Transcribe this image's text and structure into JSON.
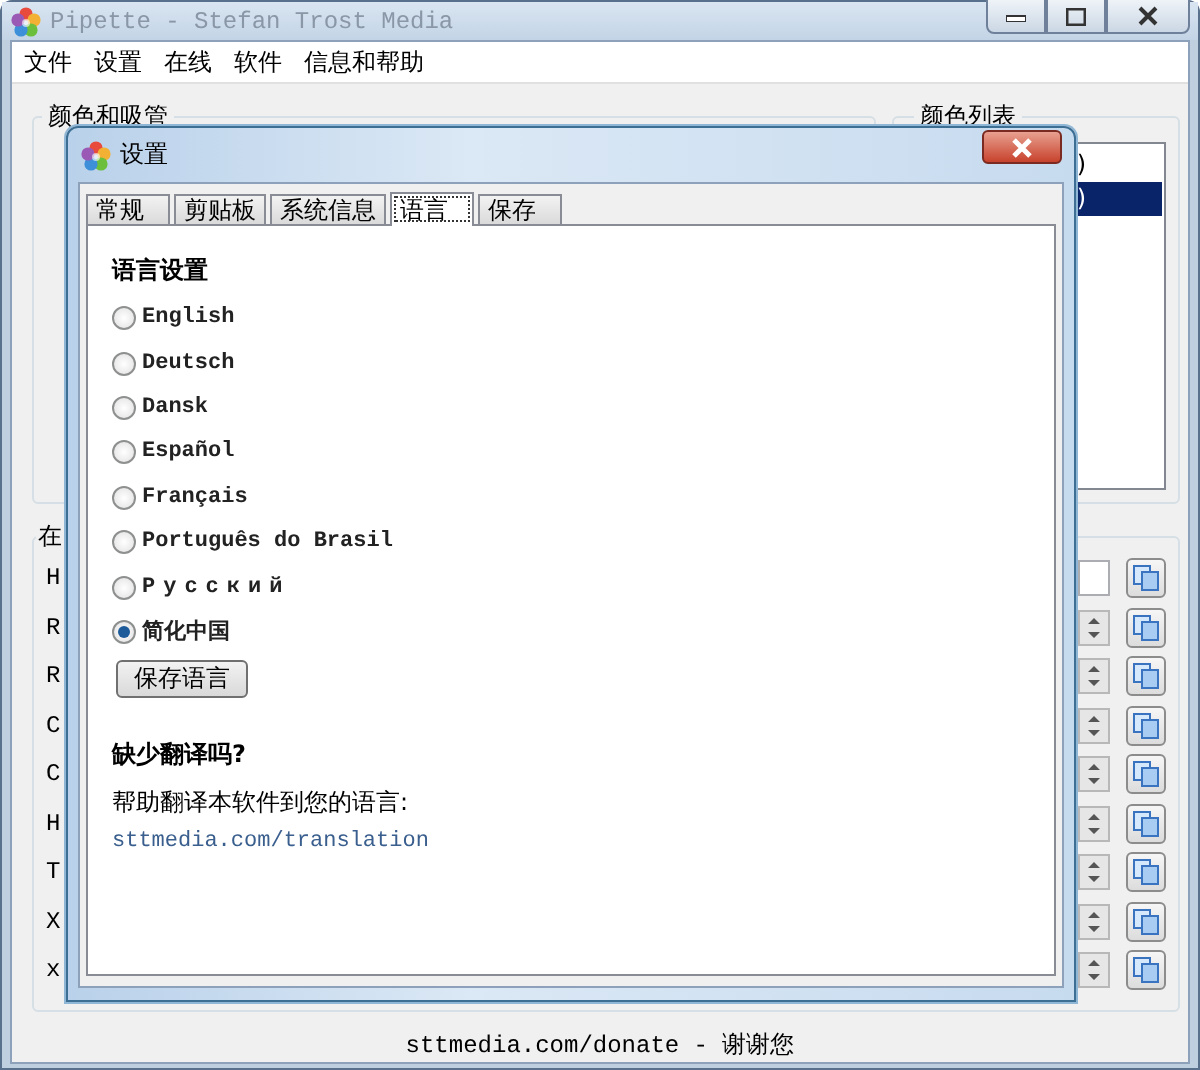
{
  "window": {
    "title": "Pipette - Stefan Trost Media"
  },
  "menu": [
    "文件",
    "设置",
    "在线",
    "软件",
    "信息和帮助"
  ],
  "color_group": {
    "title": "颜色和吸管"
  },
  "color_list": {
    "title": "颜色列表",
    "items": [
      {
        "text": ")",
        "selected": false
      },
      {
        "text": ")",
        "selected": true
      }
    ]
  },
  "values_group": {
    "title": "在",
    "rows": [
      {
        "label": "H",
        "kind": "field"
      },
      {
        "label": "R",
        "kind": "spinner"
      },
      {
        "label": "R",
        "kind": "spinner"
      },
      {
        "label": "C",
        "kind": "spinner"
      },
      {
        "label": "C",
        "kind": "spinner"
      },
      {
        "label": "H",
        "kind": "spinner"
      },
      {
        "label": "T",
        "kind": "spinner"
      },
      {
        "label": "X",
        "kind": "spinner"
      },
      {
        "label": "x",
        "kind": "spinner"
      }
    ]
  },
  "footer": "sttmedia.com/donate - 谢谢您",
  "dialog": {
    "title": "设置",
    "tabs": [
      {
        "label": "常规",
        "selected": false
      },
      {
        "label": "剪贴板",
        "selected": false
      },
      {
        "label": "系统信息",
        "selected": false
      },
      {
        "label": "语言",
        "selected": true
      },
      {
        "label": "保存",
        "selected": false
      }
    ],
    "heading": "语言设置",
    "languages": [
      {
        "label": "English",
        "selected": false
      },
      {
        "label": "Deutsch",
        "selected": false
      },
      {
        "label": "Dansk",
        "selected": false
      },
      {
        "label": "Español",
        "selected": false
      },
      {
        "label": "Français",
        "selected": false
      },
      {
        "label": "Português do Brasil",
        "selected": false
      },
      {
        "label": "Русский",
        "selected": false
      },
      {
        "label": "简化中国",
        "selected": true
      }
    ],
    "save_button": "保存语言",
    "missing_heading": "缺少翻译吗?",
    "help_text": "帮助翻译本软件到您的语言:",
    "link": "sttmedia.com/translation"
  }
}
